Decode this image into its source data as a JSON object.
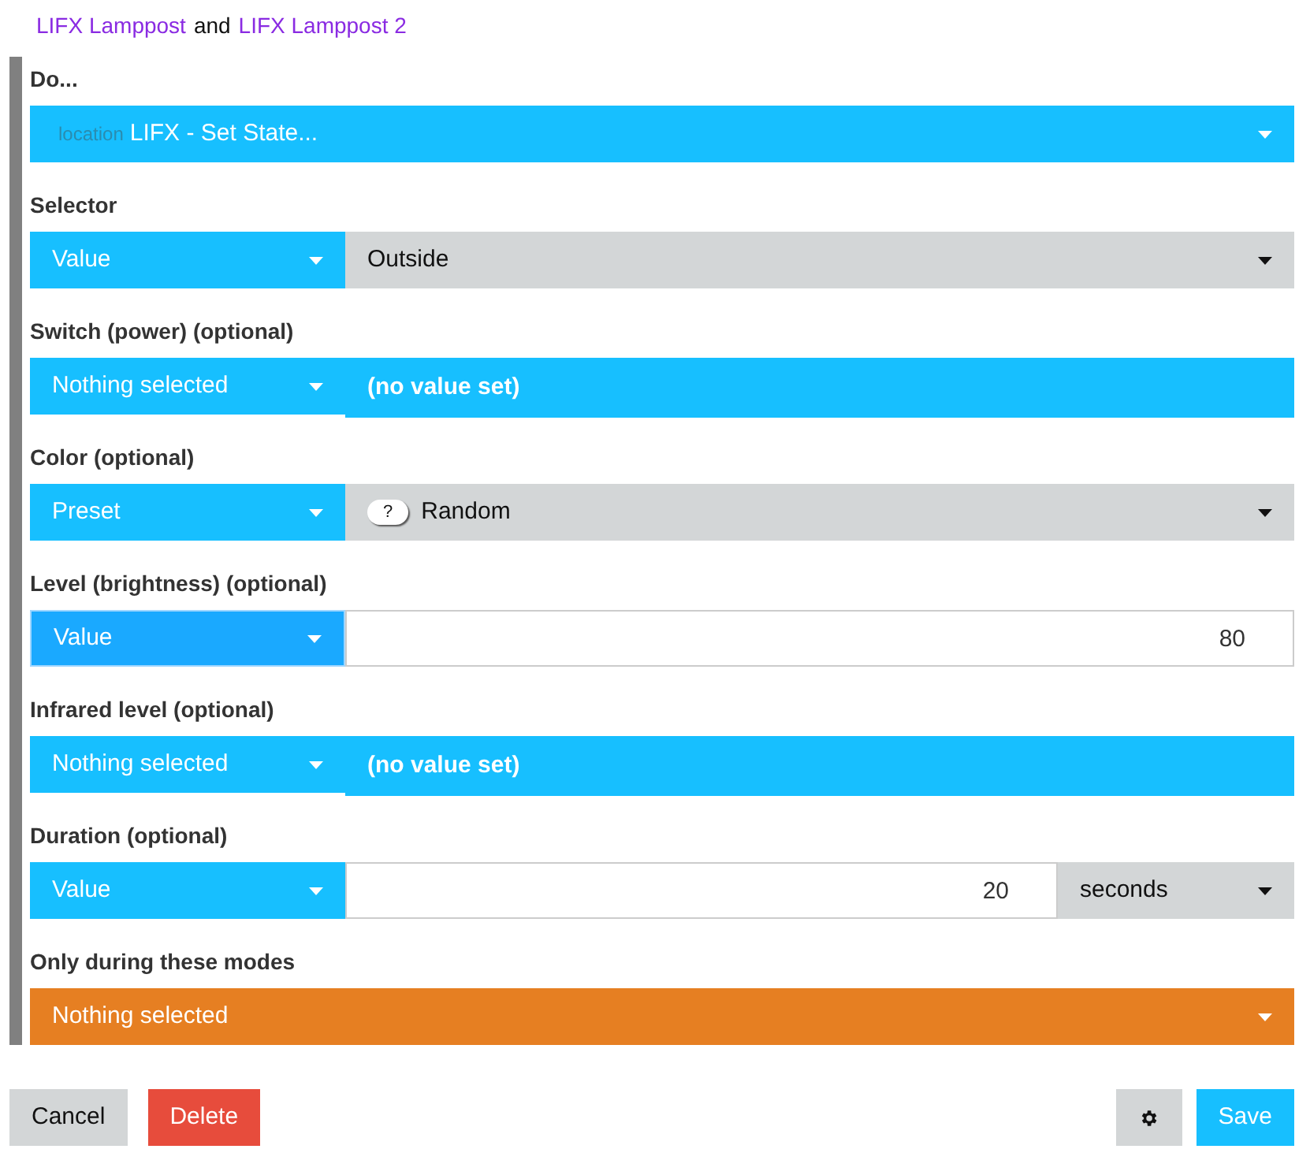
{
  "header": [
    {
      "kind": "link",
      "text": "LIFX Lamppost"
    },
    {
      "kind": "text",
      "text": "and"
    },
    {
      "kind": "link",
      "text": "LIFX Lamppost 2"
    }
  ],
  "fields": [
    {
      "label": "Do...",
      "kind": "action",
      "prefix": "location",
      "value": "LIFX - Set State..."
    },
    {
      "label": "Selector",
      "kind": "mode",
      "mode": "Value",
      "focused": false,
      "target": {
        "kind": "select",
        "value": "Outside"
      }
    },
    {
      "label": "Switch (power) (optional)",
      "kind": "mode",
      "mode": "Nothing selected",
      "focused": false,
      "target": {
        "kind": "empty",
        "text": "(no value set)"
      }
    },
    {
      "label": "Color (optional)",
      "kind": "mode",
      "mode": "Preset",
      "focused": false,
      "target": {
        "kind": "select",
        "badge": "?",
        "value": "Random"
      }
    },
    {
      "label": "Level (brightness) (optional)",
      "kind": "mode",
      "mode": "Value",
      "focused": true,
      "target": {
        "kind": "input",
        "value": "80"
      }
    },
    {
      "label": "Infrared level (optional)",
      "kind": "mode",
      "mode": "Nothing selected",
      "focused": false,
      "target": {
        "kind": "empty",
        "text": "(no value set)"
      }
    },
    {
      "label": "Duration (optional)",
      "kind": "mode",
      "mode": "Value",
      "focused": false,
      "target": {
        "kind": "input",
        "value": "20",
        "unit": "seconds"
      }
    },
    {
      "label": "Only during these modes",
      "kind": "modes",
      "value": "Nothing selected"
    }
  ],
  "buttons_left": [
    {
      "kind": "secondary",
      "label": "Cancel"
    },
    {
      "kind": "danger",
      "label": "Delete"
    }
  ],
  "buttons_right": [
    {
      "kind": "settings"
    },
    {
      "kind": "primary",
      "label": "Save"
    }
  ]
}
